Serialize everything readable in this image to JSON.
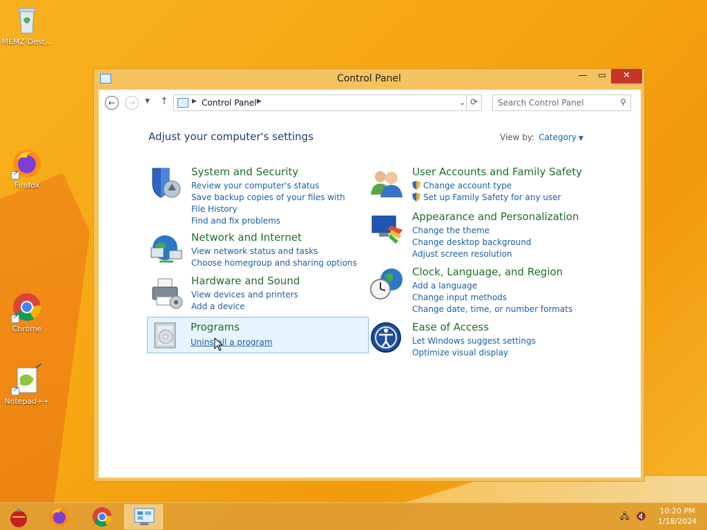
{
  "desktop": {
    "icons": [
      {
        "label": "MEMZ-Dest..."
      },
      {
        "label": "Firefox"
      },
      {
        "label": "Chrome"
      },
      {
        "label": "Notepad++"
      }
    ]
  },
  "window": {
    "title": "Control Panel",
    "close_glyph": "✕",
    "maximize_glyph": "▭",
    "minimize_glyph": "—"
  },
  "address": {
    "crumb": "Control Panel",
    "search_placeholder": "Search Control Panel"
  },
  "main": {
    "heading": "Adjust your computer's settings",
    "view_by_label": "View by:",
    "view_by_value": "Category"
  },
  "categories": [
    {
      "title": "System and Security",
      "links": [
        "Review your computer's status",
        "Save backup copies of your files with File History",
        "Find and fix problems"
      ]
    },
    {
      "title": "Network and Internet",
      "links": [
        "View network status and tasks",
        "Choose homegroup and sharing options"
      ]
    },
    {
      "title": "Hardware and Sound",
      "links": [
        "View devices and printers",
        "Add a device"
      ]
    },
    {
      "title": "Programs",
      "links": [
        "Uninstall a program"
      ]
    },
    {
      "title": "User Accounts and Family Safety",
      "links": [
        "Change account type",
        "Set up Family Safety for any user"
      ]
    },
    {
      "title": "Appearance and Personalization",
      "links": [
        "Change the theme",
        "Change desktop background",
        "Adjust screen resolution"
      ]
    },
    {
      "title": "Clock, Language, and Region",
      "links": [
        "Add a language",
        "Change input methods",
        "Change date, time, or number formats"
      ]
    },
    {
      "title": "Ease of Access",
      "links": [
        "Let Windows suggest settings",
        "Optimize visual display"
      ]
    }
  ],
  "taskbar": {
    "clock_time": "10:20 PM",
    "clock_date": "1/18/2024"
  }
}
